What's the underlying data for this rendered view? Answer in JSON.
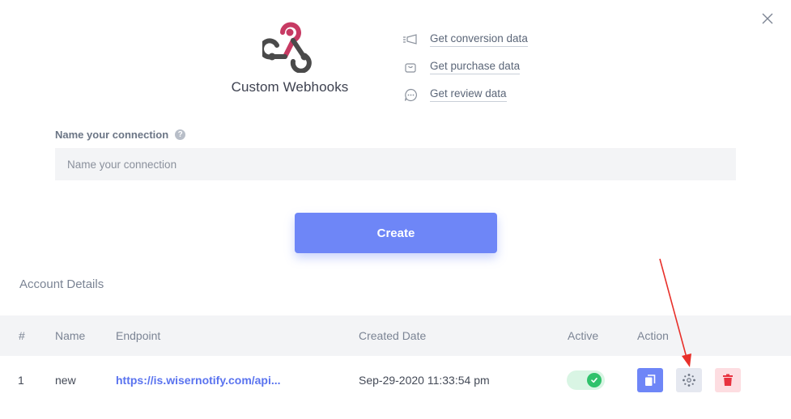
{
  "integration": {
    "name": "Custom Webhooks"
  },
  "links": [
    {
      "label": "Get conversion data",
      "icon": "megaphone-icon"
    },
    {
      "label": "Get purchase data",
      "icon": "shopping-bag-icon"
    },
    {
      "label": "Get review data",
      "icon": "chat-bubble-icon"
    }
  ],
  "form": {
    "label": "Name your connection",
    "help": "?",
    "placeholder": "Name your connection",
    "value": "",
    "create_label": "Create"
  },
  "account": {
    "title": "Account Details",
    "columns": [
      "#",
      "Name",
      "Endpoint",
      "Created Date",
      "Active",
      "Action"
    ],
    "rows": [
      {
        "index": "1",
        "name": "new",
        "endpoint": "https://is.wisernotify.com/api...",
        "created": "Sep-29-2020 11:33:54 pm",
        "active": true
      }
    ]
  },
  "colors": {
    "accent": "#6e86f7",
    "link": "#5a73ef",
    "active_green": "#2fc26b",
    "delete_red": "#e8323f",
    "annotation_arrow": "#e8302a"
  }
}
